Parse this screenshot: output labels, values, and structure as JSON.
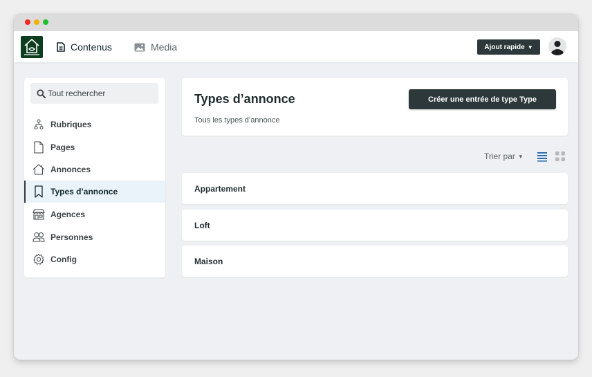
{
  "nav": {
    "contenus": "Contenus",
    "media": "Media",
    "quick_add": "Ajout rapide"
  },
  "sidebar": {
    "search_placeholder": "Tout rechercher",
    "items": [
      {
        "label": "Rubriques",
        "icon": "hierarchy-icon"
      },
      {
        "label": "Pages",
        "icon": "page-icon"
      },
      {
        "label": "Annonces",
        "icon": "house-icon"
      },
      {
        "label": "Types d’annonce",
        "icon": "bookmark-icon",
        "active": true
      },
      {
        "label": "Agences",
        "icon": "store-icon"
      },
      {
        "label": "Personnes",
        "icon": "people-icon"
      },
      {
        "label": "Config",
        "icon": "gear-icon"
      }
    ]
  },
  "main": {
    "title": "Types d’annonce",
    "subtitle": "Tous les types d’annonce",
    "create_button": "Créer une entrée de type Type",
    "sort_label": "Trier par",
    "rows": [
      "Appartement",
      "Loft",
      "Maison"
    ]
  },
  "colors": {
    "primary_dark": "#2c3839",
    "logo_green": "#0c3d1f",
    "active_bg": "#eaf3f9",
    "list_view_active": "#2b6cb0"
  }
}
